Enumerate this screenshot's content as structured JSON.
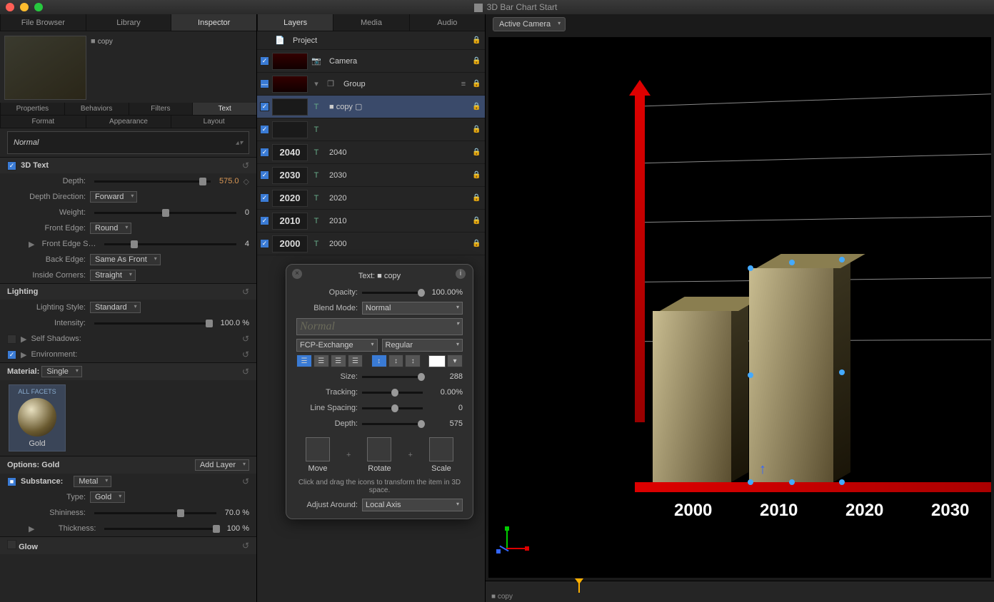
{
  "window": {
    "title": "3D Bar Chart Start"
  },
  "topTabsLeft": [
    "File Browser",
    "Library",
    "Inspector"
  ],
  "topTabsLeftActive": 2,
  "topTabsMid": [
    "Layers",
    "Media",
    "Audio"
  ],
  "topTabsMidActive": 0,
  "preview": {
    "objectName": "copy"
  },
  "inspectorSubTabs": [
    "Properties",
    "Behaviors",
    "Filters",
    "Text"
  ],
  "inspectorSubActive": 3,
  "textSubTabs": [
    "Format",
    "Appearance",
    "Layout"
  ],
  "fontPreview": "Normal",
  "threeD": {
    "heading": "3D Text",
    "depth_label": "Depth:",
    "depth": "575.0",
    "depthDir_label": "Depth Direction:",
    "depthDir": "Forward",
    "weight_label": "Weight:",
    "weight": "0",
    "frontEdge_label": "Front Edge:",
    "frontEdge": "Round",
    "frontEdgeSize_label": "Front Edge S…",
    "frontEdgeSize": "4",
    "backEdge_label": "Back Edge:",
    "backEdge": "Same As Front",
    "insideCorners_label": "Inside Corners:",
    "insideCorners": "Straight"
  },
  "lighting": {
    "heading": "Lighting",
    "style_label": "Lighting Style:",
    "style": "Standard",
    "intensity_label": "Intensity:",
    "intensity": "100.0 %",
    "selfShadows_label": "Self Shadows:",
    "environment_label": "Environment:"
  },
  "material": {
    "heading_label": "Material:",
    "heading_val": "Single",
    "facets": "ALL FACETS",
    "name": "Gold",
    "options_label": "Options: Gold",
    "addlayer": "Add Layer",
    "substance_label": "Substance:",
    "substance": "Metal",
    "type_label": "Type:",
    "type": "Gold",
    "shininess_label": "Shininess:",
    "shininess": "70.0 %",
    "thickness_label": "Thickness:",
    "thickness": "100 %",
    "glow": "Glow"
  },
  "layers": {
    "project": "Project",
    "camera": "Camera",
    "group": "Group",
    "items": [
      {
        "thumb": "",
        "name": "copy",
        "sel": true,
        "icon": "text"
      },
      {
        "thumb": "",
        "name": "",
        "icon": "text"
      },
      {
        "thumb": "2040",
        "name": "2040",
        "icon": "text"
      },
      {
        "thumb": "2030",
        "name": "2030",
        "icon": "text"
      },
      {
        "thumb": "2020",
        "name": "2020",
        "icon": "text"
      },
      {
        "thumb": "2010",
        "name": "2010",
        "icon": "text"
      },
      {
        "thumb": "2000",
        "name": "2000",
        "icon": "text"
      }
    ]
  },
  "hud": {
    "title": "Text: ■ copy",
    "opacity_label": "Opacity:",
    "opacity": "100.00%",
    "blend_label": "Blend Mode:",
    "blend": "Normal",
    "fontPreview": "Normal",
    "font": "FCP-Exchange",
    "style": "Regular",
    "size_label": "Size:",
    "size": "288",
    "tracking_label": "Tracking:",
    "tracking": "0.00%",
    "lineSpacing_label": "Line Spacing:",
    "lineSpacing": "0",
    "depth_label": "Depth:",
    "depth": "575",
    "move": "Move",
    "rotate": "Rotate",
    "scale": "Scale",
    "hint": "Click and drag the icons to transform the item in 3D space.",
    "adjust_label": "Adjust Around:",
    "adjust": "Local Axis"
  },
  "viewport": {
    "camera": "Active Camera",
    "xlabels": [
      "2000",
      "2010",
      "2020",
      "2030"
    ]
  },
  "chart_data": {
    "type": "bar",
    "categories": [
      "2000",
      "2010",
      "2020",
      "2030",
      "2040"
    ],
    "values": [
      240,
      300,
      null,
      null,
      null
    ],
    "title": "3D Bar Chart Start",
    "xlabel": "",
    "ylabel": "",
    "ylim": [
      0,
      500
    ],
    "note": "Only bars for 2000 and 2010 rendered in viewport; heights estimated from gridlines (5 gridlines spanning y-axis)."
  }
}
